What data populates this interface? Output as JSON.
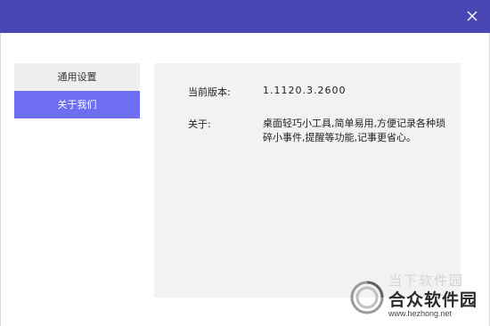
{
  "window": {
    "close_icon": "close-icon",
    "titlebar_color": "#4a46b3"
  },
  "sidebar": {
    "items": [
      {
        "label": "通用设置",
        "active": false
      },
      {
        "label": "关于我们",
        "active": true
      }
    ],
    "active_color": "#6e6ef0"
  },
  "about": {
    "version_label": "当前版本:",
    "version_value": "1.1120.3.2600",
    "about_label": "关于:",
    "about_text": "桌面轻巧小工具,简单易用,方便记录各种琐碎小事件,提醒等功能,记事更省心。"
  },
  "watermark": {
    "faint_text": "当下软件园",
    "site_name": "合众软件园",
    "url": "www.hezhong.net"
  }
}
